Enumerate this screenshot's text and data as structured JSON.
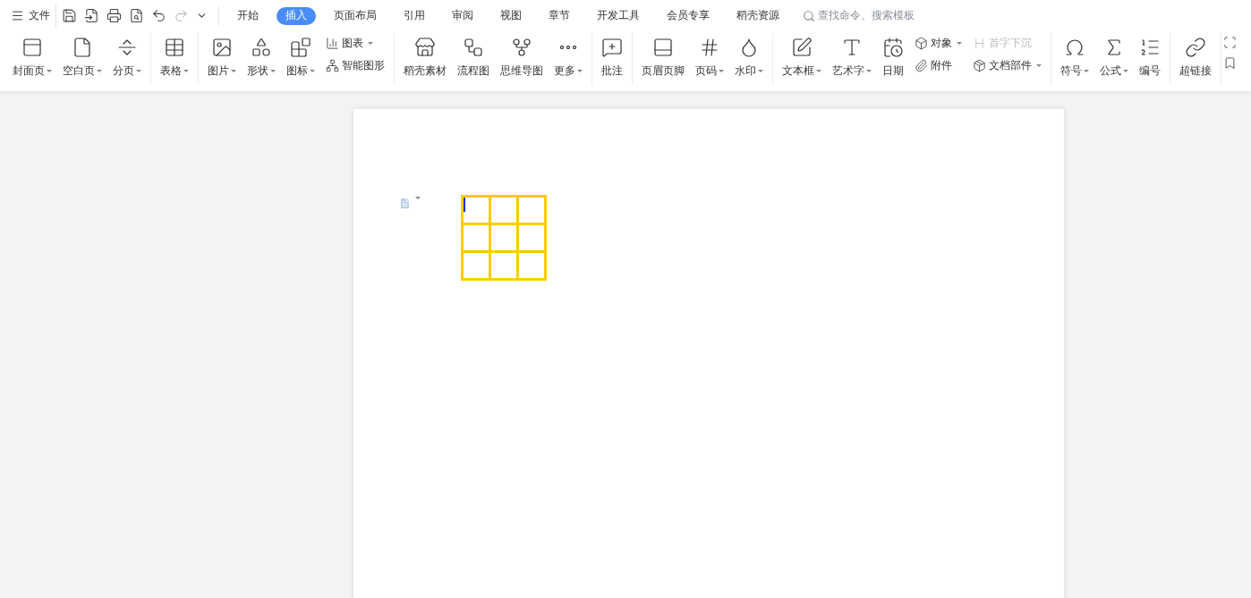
{
  "menu": {
    "label": "文件"
  },
  "tabs": [
    {
      "label": "开始",
      "selected": false
    },
    {
      "label": "插入",
      "selected": true
    },
    {
      "label": "页面布局",
      "selected": false
    },
    {
      "label": "引用",
      "selected": false
    },
    {
      "label": "审阅",
      "selected": false
    },
    {
      "label": "视图",
      "selected": false
    },
    {
      "label": "章节",
      "selected": false
    },
    {
      "label": "开发工具",
      "selected": false
    },
    {
      "label": "会员专享",
      "selected": false
    },
    {
      "label": "稻壳资源",
      "selected": false
    }
  ],
  "search": {
    "placeholder": "查找命令、搜索模板"
  },
  "ribbon_groups": [
    {
      "items": [
        {
          "kind": "large",
          "label": "封面页",
          "dropdown": true
        },
        {
          "kind": "large",
          "label": "空白页",
          "dropdown": true
        },
        {
          "kind": "large",
          "label": "分页",
          "dropdown": true
        }
      ]
    },
    {
      "items": [
        {
          "kind": "large",
          "label": "表格",
          "dropdown": true
        }
      ]
    },
    {
      "items": [
        {
          "kind": "large",
          "label": "图片",
          "dropdown": true
        },
        {
          "kind": "large",
          "label": "形状",
          "dropdown": true
        },
        {
          "kind": "large",
          "label": "图标",
          "dropdown": true
        },
        {
          "kind": "stack",
          "items": [
            {
              "label": "图表",
              "dropdown": true,
              "disabled": false
            },
            {
              "label": "智能图形",
              "dropdown": false,
              "disabled": false
            }
          ]
        }
      ]
    },
    {
      "items": [
        {
          "kind": "large",
          "label": "稻壳素材",
          "dropdown": false
        },
        {
          "kind": "large",
          "label": "流程图",
          "dropdown": false
        },
        {
          "kind": "large",
          "label": "思维导图",
          "dropdown": false
        },
        {
          "kind": "large",
          "label": "更多",
          "dropdown": true
        }
      ]
    },
    {
      "items": [
        {
          "kind": "large",
          "label": "批注",
          "dropdown": false
        }
      ]
    },
    {
      "items": [
        {
          "kind": "large",
          "label": "页眉页脚",
          "dropdown": false
        },
        {
          "kind": "large",
          "label": "页码",
          "dropdown": true
        },
        {
          "kind": "large",
          "label": "水印",
          "dropdown": true
        }
      ]
    },
    {
      "items": [
        {
          "kind": "large",
          "label": "文本框",
          "dropdown": true
        },
        {
          "kind": "large",
          "label": "艺术字",
          "dropdown": true
        },
        {
          "kind": "large",
          "label": "日期",
          "dropdown": false
        },
        {
          "kind": "stack",
          "items": [
            {
              "label": "对象",
              "dropdown": true,
              "disabled": false
            },
            {
              "label": "附件",
              "dropdown": false,
              "disabled": false
            }
          ]
        },
        {
          "kind": "stack",
          "items": [
            {
              "label": "首字下沉",
              "dropdown": false,
              "disabled": true
            },
            {
              "label": "文档部件",
              "dropdown": true,
              "disabled": false
            }
          ]
        }
      ]
    },
    {
      "items": [
        {
          "kind": "large",
          "label": "符号",
          "dropdown": true
        },
        {
          "kind": "large",
          "label": "公式",
          "dropdown": true
        },
        {
          "kind": "large",
          "label": "编号",
          "dropdown": false
        }
      ]
    },
    {
      "items": [
        {
          "kind": "large",
          "label": "超链接",
          "dropdown": false
        }
      ]
    }
  ]
}
